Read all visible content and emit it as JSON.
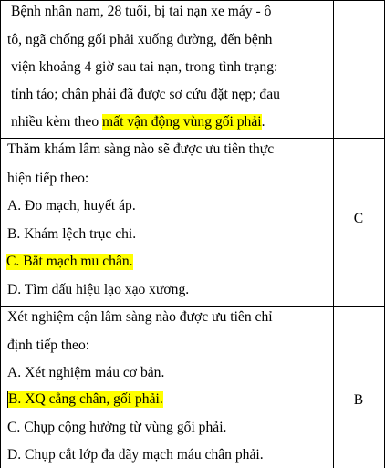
{
  "case": {
    "lines": [
      "Bệnh nhân nam, 28 tuổi, bị tai nạn xe máy - ô",
      "tô, ngã chống gối phải xuống đường, đến bệnh",
      "viện khoảng 4 giờ sau tai nạn, trong tình trạng:",
      "tỉnh táo; chân phải đã được sơ cứu đặt nẹp; đau"
    ],
    "last_plain": "nhiều kèm theo ",
    "last_highlight": "mất vận động vùng gối phải",
    "last_end": "."
  },
  "q1": {
    "stem1": "Thăm khám lâm sàng nào sẽ được ưu tiên thực",
    "stem2": "hiện tiếp theo:",
    "options": [
      "A. Đo mạch, huyết áp.",
      "B. Khám lệch trục chi.",
      "C. Bắt mạch mu chân.",
      "D. Tìm dấu hiệu lạo xạo xương."
    ],
    "answer": "C"
  },
  "q2": {
    "stem1": "Xét nghiệm cận lâm sàng nào được ưu tiên chỉ",
    "stem2": "định tiếp theo:",
    "options": [
      "A. Xét nghiệm máu cơ bản.",
      "B. XQ cẳng chân, gối phải.",
      "C. Chụp cộng hưởng từ vùng gối phải.",
      "D. Chụp cắt lớp đa dãy mạch máu chân phải."
    ],
    "answer": "B"
  },
  "colors": {
    "highlight": "#ffff00",
    "border": "#000000"
  }
}
